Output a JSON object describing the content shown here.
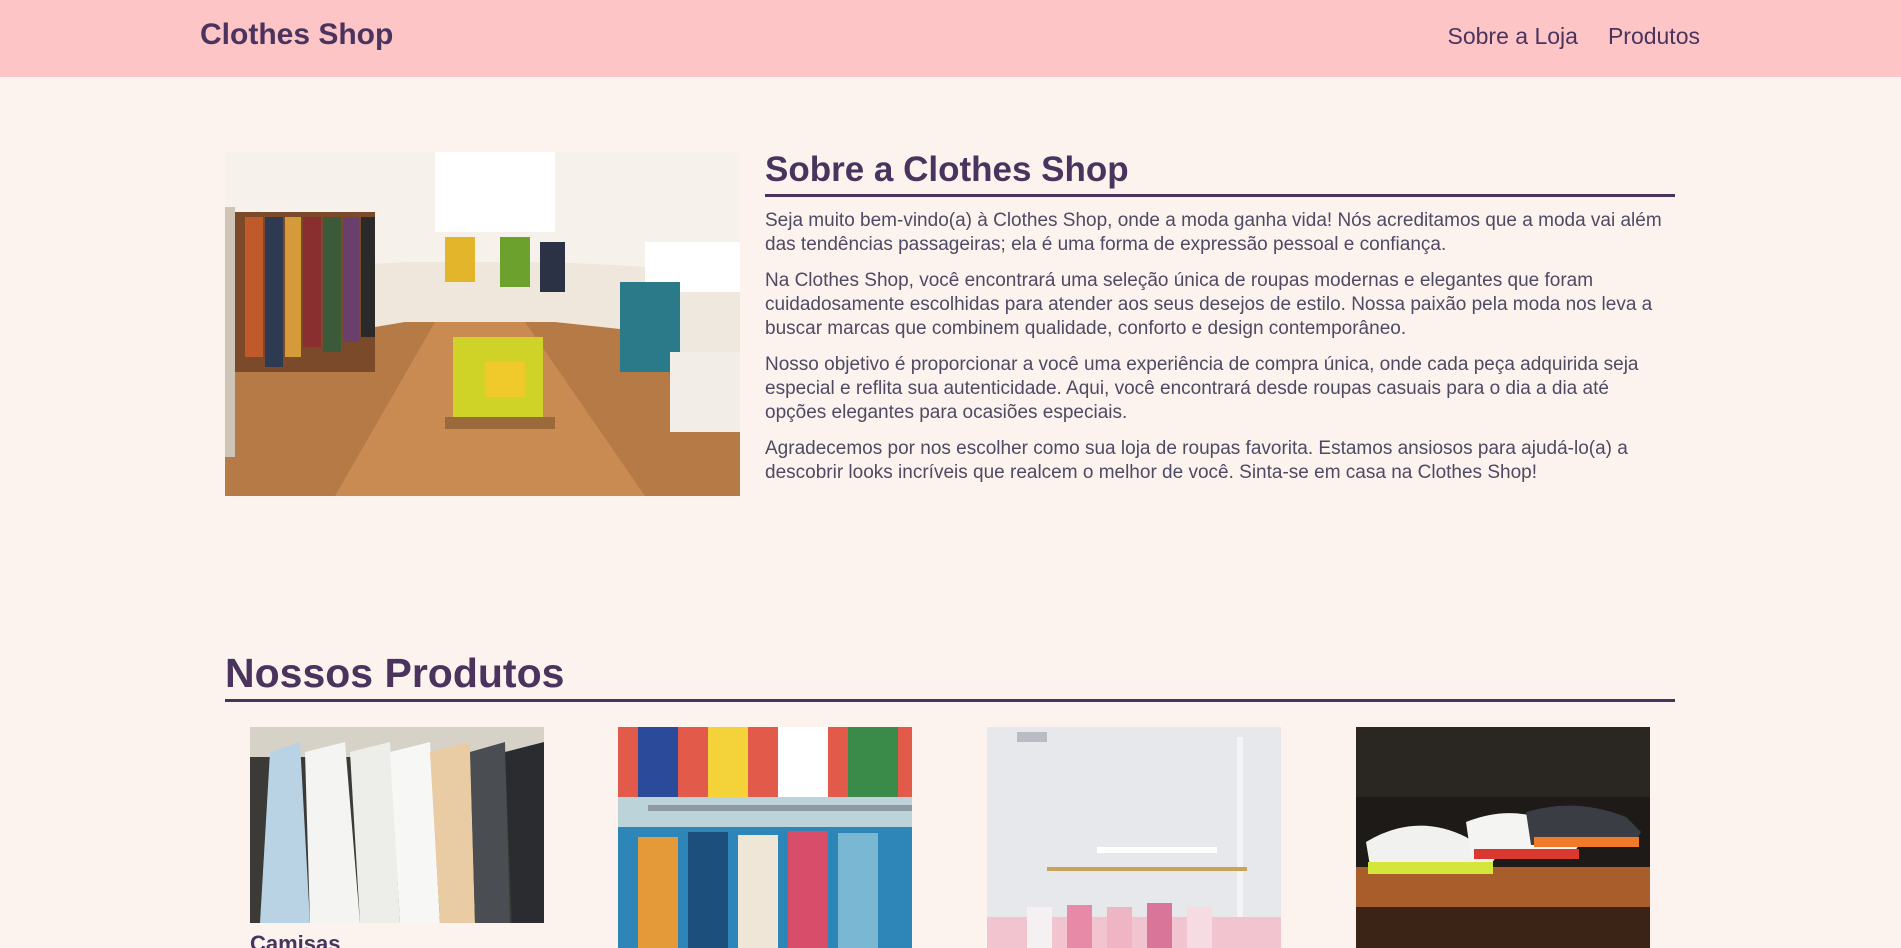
{
  "navbar": {
    "brand": "Clothes Shop",
    "links": [
      {
        "label": "Sobre a Loja"
      },
      {
        "label": "Produtos"
      }
    ]
  },
  "about": {
    "title": "Sobre a Clothes Shop",
    "paragraphs": [
      "Seja muito bem-vindo(a) à Clothes Shop, onde a moda ganha vida! Nós acreditamos que a moda vai além das tendências passageiras; ela é uma forma de expressão pessoal e confiança.",
      "Na Clothes Shop, você encontrará uma seleção única de roupas modernas e elegantes que foram cuidadosamente escolhidas para atender aos seus desejos de estilo. Nossa paixão pela moda nos leva a buscar marcas que combinem qualidade, conforto e design contemporâneo.",
      "Nosso objetivo é proporcionar a você uma experiência de compra única, onde cada peça adquirida seja especial e reflita sua autenticidade. Aqui, você encontrará desde roupas casuais para o dia a dia até opções elegantes para ocasiões especiais.",
      "Agradecemos por nos escolher como sua loja de roupas favorita. Estamos ansiosos para ajudá-lo(a) a descobrir looks incríveis que realcem o melhor de você. Sinta-se em casa na Clothes Shop!"
    ]
  },
  "products": {
    "title": "Nossos Produtos",
    "items": [
      {
        "name": "Camisas"
      },
      {
        "name": ""
      },
      {
        "name": ""
      },
      {
        "name": ""
      }
    ]
  },
  "colors": {
    "navbar_bg": "#fec5c7",
    "page_bg": "#fcf2ee",
    "accent": "#4a345d"
  }
}
